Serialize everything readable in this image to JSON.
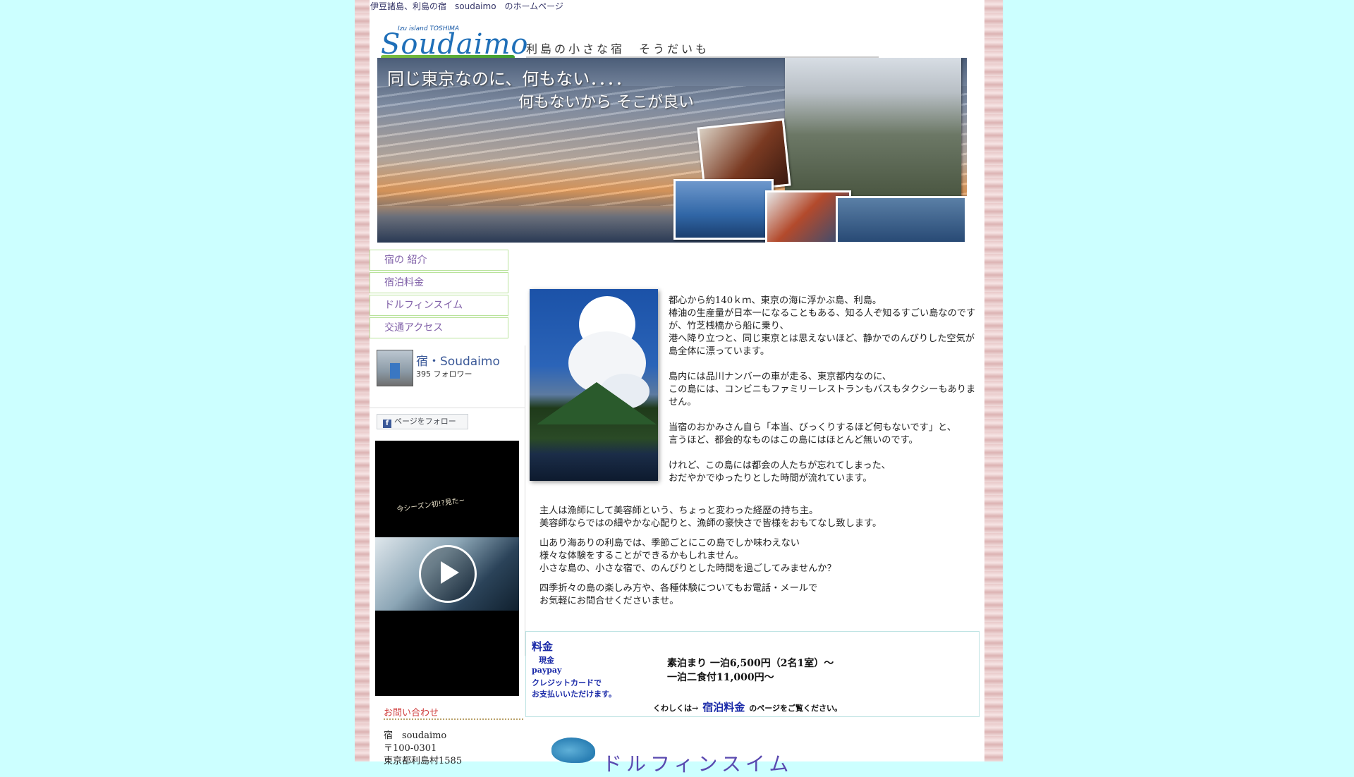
{
  "header": {
    "topline": "伊豆諸島、利島の宿　soudaimo　のホームページ",
    "logo_island": "Izu island  TOSHIMA",
    "logo_word": "Soudaimo",
    "logo_tagline": "利島の小さな宿　そうだいも"
  },
  "hero": {
    "line1": "同じ東京なのに、何もない．．．．",
    "line2": "何もないから そこが良い"
  },
  "nav": {
    "items": [
      "宿の 紹介",
      "宿泊料金",
      "ドルフィンスイム",
      "交通アクセス"
    ]
  },
  "facebook": {
    "name": "宿・Soudaimo",
    "followers": "395 フォロワー",
    "follow_label": "ページをフォロー"
  },
  "video": {
    "caption": "今シーズン初!?見た~"
  },
  "contact": {
    "title": "お問い合わせ",
    "lines": [
      "宿　soudaimo",
      "〒100-0301",
      "東京都利島村1585"
    ]
  },
  "intro": {
    "p1": [
      "都心から約140ｋｍ、東京の海に浮かぶ島、利島。",
      "椿油の生産量が日本一になることもある、知る人ぞ知るすごい島なのですが、竹芝桟橋から船に乗り、",
      "港へ降り立つと、同じ東京とは思えないほど、静かでのんびりした空気が島全体に漂っています。"
    ],
    "p2": [
      "島内には品川ナンバーの車が走る、東京都内なのに、",
      "この島には、コンビニもファミリーレストランもバスもタクシーもありません。"
    ],
    "p3": [
      "当宿のおかみさん自ら「本当、びっくりするほど何もないです」と、",
      "言うほど、都会的なものはこの島にはほとんど無いのです。"
    ],
    "p4": [
      "けれど、この島には都会の人たちが忘れてしまった、",
      "おだやかでゆったりとした時間が流れています。"
    ]
  },
  "intro2": {
    "p1": [
      "主人は漁師にして美容師という、ちょっと変わった経歴の持ち主。",
      "美容師ならではの細やかな心配りと、漁師の豪快さで皆様をおもてなし致します。"
    ],
    "p2": [
      "山あり海ありの利島では、季節ごとにこの島でしか味わえない",
      "様々な体験をすることができるかもしれません。",
      "小さな島の、小さな宿で、のんびりとした時間を過ごしてみませんか？"
    ],
    "p3": [
      "四季折々の島の楽しみ方や、各種体験についてもお電話・メールで",
      "お気軽にお問合せくださいませ。"
    ]
  },
  "price": {
    "title": "料金",
    "pay_methods": [
      "現金",
      "paypay",
      "クレジットカードで",
      "お支払いいただけます。"
    ],
    "plan1": "素泊まり 一泊6,500円（2名1室）～",
    "plan2": "一泊二食付11,000円～",
    "more_prefix": "くわしくは→",
    "more_link": "宿泊料金",
    "more_suffix": "のページをご覧ください。"
  },
  "dolphin_section": {
    "title": "ドルフィンスイム"
  }
}
